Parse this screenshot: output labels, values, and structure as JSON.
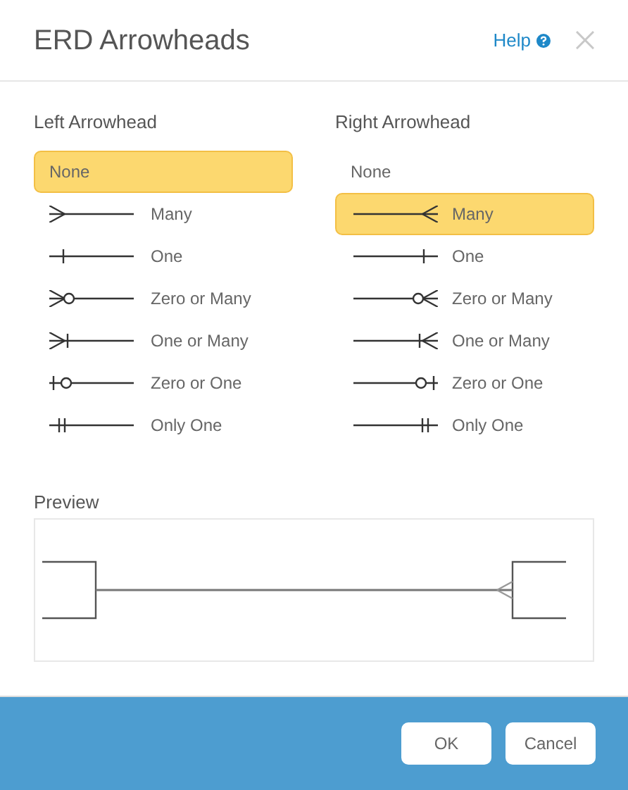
{
  "dialog": {
    "title": "ERD Arrowheads",
    "help_link": "Help"
  },
  "left": {
    "heading": "Left Arrowhead",
    "items": [
      {
        "kind": "none",
        "label": "None",
        "selected": true
      },
      {
        "kind": "many",
        "label": "Many",
        "selected": false
      },
      {
        "kind": "one",
        "label": "One",
        "selected": false
      },
      {
        "kind": "zero_many",
        "label": "Zero or Many",
        "selected": false
      },
      {
        "kind": "one_many",
        "label": "One or Many",
        "selected": false
      },
      {
        "kind": "zero_one",
        "label": "Zero or One",
        "selected": false
      },
      {
        "kind": "only_one",
        "label": "Only One",
        "selected": false
      }
    ]
  },
  "right": {
    "heading": "Right Arrowhead",
    "items": [
      {
        "kind": "none",
        "label": "None",
        "selected": false
      },
      {
        "kind": "many",
        "label": "Many",
        "selected": true
      },
      {
        "kind": "one",
        "label": "One",
        "selected": false
      },
      {
        "kind": "zero_many",
        "label": "Zero or Many",
        "selected": false
      },
      {
        "kind": "one_many",
        "label": "One or Many",
        "selected": false
      },
      {
        "kind": "zero_one",
        "label": "Zero or One",
        "selected": false
      },
      {
        "kind": "only_one",
        "label": "Only One",
        "selected": false
      }
    ]
  },
  "preview": {
    "heading": "Preview"
  },
  "buttons": [
    "OK",
    "Cancel"
  ]
}
